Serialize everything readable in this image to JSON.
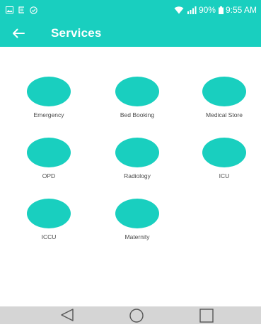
{
  "status_bar": {
    "battery": "90%",
    "time": "9:55 AM",
    "icons": [
      "image-icon",
      "notification-icon",
      "shield-check-icon",
      "wifi-icon",
      "signal-icon",
      "battery-icon"
    ]
  },
  "app_bar": {
    "title": "Services",
    "back_icon": "arrow-left-icon",
    "color": "#19cfbf"
  },
  "services": [
    {
      "label": "Emergency"
    },
    {
      "label": "Bed Booking"
    },
    {
      "label": "Medical Store"
    },
    {
      "label": "OPD"
    },
    {
      "label": "Radiology"
    },
    {
      "label": "ICU"
    },
    {
      "label": "ICCU"
    },
    {
      "label": "Maternity"
    }
  ],
  "nav_bar": {
    "icons": [
      "back-triangle-icon",
      "home-circle-icon",
      "recents-square-icon"
    ]
  }
}
